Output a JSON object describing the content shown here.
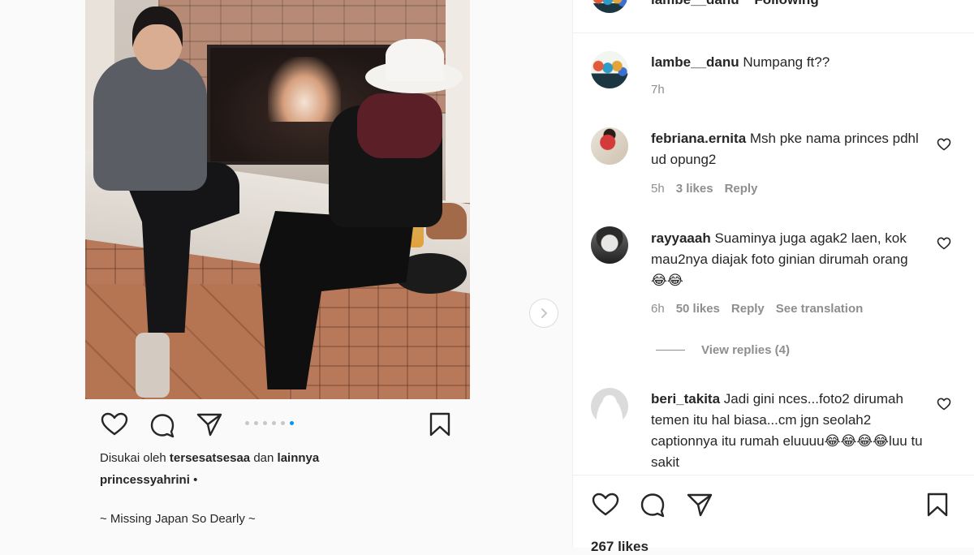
{
  "post": {
    "liked_by_prefix": "Disukai oleh",
    "liked_by_user": "tersesatsesaa",
    "liked_by_and": "dan",
    "liked_by_others": "lainnya",
    "author": "princessyahrini",
    "author_suffix": "•",
    "caption": "~ Missing Japan So Dearly ~",
    "carousel_dots": 6,
    "carousel_active": 6
  },
  "header_partial": {
    "username": "lambe__danu",
    "follow_state": "Following"
  },
  "comments": [
    {
      "username": "lambe__danu",
      "text": "Numpang ft??",
      "time": "7h"
    },
    {
      "username": "febriana.ernita",
      "text": "Msh pke nama princes pdhl ud opung2",
      "time": "5h",
      "likes": "3 likes",
      "reply": "Reply"
    },
    {
      "username": "rayyaaah",
      "text": "Suaminya juga agak2 laen, kok mau2nya diajak foto ginian dirumah orang😂😂",
      "time": "6h",
      "likes": "50 likes",
      "reply": "Reply",
      "translation": "See translation",
      "view_replies": "View replies (4)"
    },
    {
      "username": "beri_takita",
      "text": "Jadi gini nces...foto2 dirumah temen itu hal biasa...cm jgn seolah2 captionnya itu rumah eluuuu😂😂😂😂luu tu sakit"
    }
  ],
  "footer": {
    "likes_partial": "267 likes"
  },
  "colors": {
    "accent": "#0095f6",
    "text": "#262626",
    "muted": "#8e8e8e"
  }
}
